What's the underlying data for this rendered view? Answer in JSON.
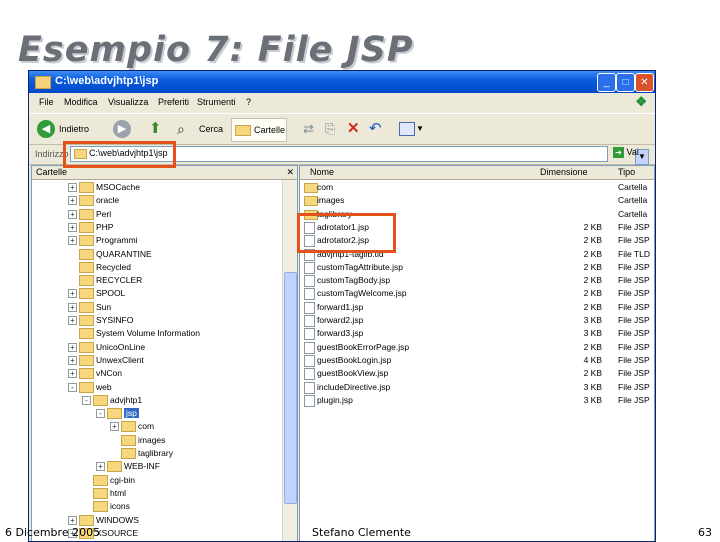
{
  "slide": {
    "title": "Esempio 7: File JSP",
    "footer_date": "6 Dicembre 2005",
    "footer_author": "Stefano Clemente",
    "footer_page": "63"
  },
  "window": {
    "title": "C:\\web\\advjhtp1\\jsp",
    "controls": {
      "minimize": "_",
      "maximize": "□",
      "close": "✕"
    }
  },
  "menu": [
    "File",
    "Modifica",
    "Visualizza",
    "Preferiti",
    "Strumenti",
    "?"
  ],
  "toolbar": {
    "back_label": "Indietro",
    "search_label": "Cerca",
    "folders_label": "Cartelle"
  },
  "address": {
    "label": "Indirizzo",
    "value": "C:\\web\\advjhtp1\\jsp",
    "go_label": "Vai"
  },
  "folders_pane": {
    "header": "Cartelle",
    "items": [
      {
        "label": "MSOCache",
        "depth": 0,
        "expander": "+"
      },
      {
        "label": "oracle",
        "depth": 0,
        "expander": "+"
      },
      {
        "label": "Perl",
        "depth": 0,
        "expander": "+"
      },
      {
        "label": "PHP",
        "depth": 0,
        "expander": "+"
      },
      {
        "label": "Programmi",
        "depth": 0,
        "expander": "+"
      },
      {
        "label": "QUARANTINE",
        "depth": 0,
        "expander": ""
      },
      {
        "label": "Recycled",
        "depth": 0,
        "expander": ""
      },
      {
        "label": "RECYCLER",
        "depth": 0,
        "expander": ""
      },
      {
        "label": "SPOOL",
        "depth": 0,
        "expander": "+"
      },
      {
        "label": "Sun",
        "depth": 0,
        "expander": "+"
      },
      {
        "label": "SYSINFO",
        "depth": 0,
        "expander": "+"
      },
      {
        "label": "System Volume Information",
        "depth": 0,
        "expander": ""
      },
      {
        "label": "UnicoOnLine",
        "depth": 0,
        "expander": "+"
      },
      {
        "label": "UnwexClient",
        "depth": 0,
        "expander": "+"
      },
      {
        "label": "vNCon",
        "depth": 0,
        "expander": "+"
      },
      {
        "label": "web",
        "depth": 0,
        "expander": "-"
      },
      {
        "label": "advjhtp1",
        "depth": 1,
        "expander": "-"
      },
      {
        "label": "jsp",
        "depth": 2,
        "expander": "-"
      },
      {
        "label": "com",
        "depth": 3,
        "expander": "+"
      },
      {
        "label": "images",
        "depth": 3,
        "expander": ""
      },
      {
        "label": "taglibrary",
        "depth": 3,
        "expander": ""
      },
      {
        "label": "WEB-INF",
        "depth": 2,
        "expander": "+"
      },
      {
        "label": "cgi-bin",
        "depth": 1,
        "expander": ""
      },
      {
        "label": "html",
        "depth": 1,
        "expander": ""
      },
      {
        "label": "icons",
        "depth": 1,
        "expander": ""
      },
      {
        "label": "WINDOWS",
        "depth": 0,
        "expander": "+"
      },
      {
        "label": "XSOURCE",
        "depth": 0,
        "expander": "+"
      }
    ]
  },
  "files_pane": {
    "columns": {
      "name": "Nome",
      "size": "Dimensione",
      "type": "Tipo"
    },
    "rows": [
      {
        "name": "com",
        "size": "",
        "type": "Cartella",
        "kind": "folder"
      },
      {
        "name": "images",
        "size": "",
        "type": "Cartella",
        "kind": "folder"
      },
      {
        "name": "taglibrary",
        "size": "",
        "type": "Cartella",
        "kind": "folder"
      },
      {
        "name": "adrotator1.jsp",
        "size": "2 KB",
        "type": "File JSP",
        "kind": "file"
      },
      {
        "name": "adrotator2.jsp",
        "size": "2 KB",
        "type": "File JSP",
        "kind": "file"
      },
      {
        "name": "advjhtp1-taglib.tld",
        "size": "2 KB",
        "type": "File TLD",
        "kind": "file"
      },
      {
        "name": "customTagAttribute.jsp",
        "size": "2 KB",
        "type": "File JSP",
        "kind": "file"
      },
      {
        "name": "customTagBody.jsp",
        "size": "2 KB",
        "type": "File JSP",
        "kind": "file"
      },
      {
        "name": "customTagWelcome.jsp",
        "size": "2 KB",
        "type": "File JSP",
        "kind": "file"
      },
      {
        "name": "forward1.jsp",
        "size": "2 KB",
        "type": "File JSP",
        "kind": "file"
      },
      {
        "name": "forward2.jsp",
        "size": "3 KB",
        "type": "File JSP",
        "kind": "file"
      },
      {
        "name": "forward3.jsp",
        "size": "3 KB",
        "type": "File JSP",
        "kind": "file"
      },
      {
        "name": "guestBookErrorPage.jsp",
        "size": "2 KB",
        "type": "File JSP",
        "kind": "file"
      },
      {
        "name": "guestBookLogin.jsp",
        "size": "4 KB",
        "type": "File JSP",
        "kind": "file"
      },
      {
        "name": "guestBookView.jsp",
        "size": "2 KB",
        "type": "File JSP",
        "kind": "file"
      },
      {
        "name": "includeDirective.jsp",
        "size": "3 KB",
        "type": "File JSP",
        "kind": "file"
      },
      {
        "name": "plugin.jsp",
        "size": "3 KB",
        "type": "File JSP",
        "kind": "file"
      }
    ]
  },
  "colors": {
    "highlight": "#e4521c",
    "titlebar": "#0a5ce0",
    "folder": "#f6d77e"
  }
}
